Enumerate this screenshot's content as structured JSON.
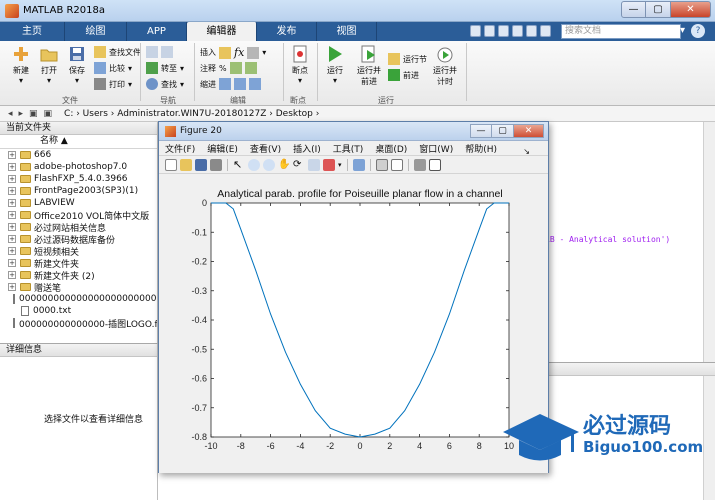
{
  "window": {
    "title": "MATLAB R2018a",
    "minimize": "—",
    "maximize": "▢",
    "close": "✕"
  },
  "tabs": [
    "主页",
    "绘图",
    "APP",
    "编辑器",
    "发布",
    "视图"
  ],
  "search_placeholder": "搜索文档",
  "ribbon": {
    "new": "新建",
    "open": "打开",
    "save": "保存",
    "find_files": "查找文件",
    "compare": "比较",
    "print": "打印",
    "goto": "转至",
    "find": "查找",
    "insert": "插入",
    "comment": "注释",
    "indent": "缩进",
    "breakpoints": "断点",
    "run": "运行",
    "run_and_advance": [
      "运行并",
      "前进"
    ],
    "run_section": "运行节",
    "advance": "前进",
    "run_and_time": [
      "运行并",
      "计时"
    ],
    "groups": {
      "file": "文件",
      "navigate": "导航",
      "edit": "编辑",
      "breakpoints": "断点",
      "run": "运行"
    }
  },
  "address": {
    "path": "C:  ›  Users  ›  Administrator.WIN7U-20180127Z  ›  Desktop  ›"
  },
  "current_folder": {
    "title": "当前文件夹",
    "column": "名称 ▲",
    "items": [
      {
        "name": "666",
        "type": "folder"
      },
      {
        "name": "adobe-photoshop7.0",
        "type": "folder"
      },
      {
        "name": "FlashFXP_5.4.0.3966",
        "type": "folder"
      },
      {
        "name": "FrontPage2003(SP3)(1)",
        "type": "folder"
      },
      {
        "name": "LABVIEW",
        "type": "folder"
      },
      {
        "name": "Office2010 VOL简体中文版",
        "type": "folder"
      },
      {
        "name": "必过网站相关信息",
        "type": "folder"
      },
      {
        "name": "必过源码数据库备份",
        "type": "folder"
      },
      {
        "name": "短视频相关",
        "type": "folder"
      },
      {
        "name": "新建文件夹",
        "type": "folder"
      },
      {
        "name": "新建文件夹 (2)",
        "type": "folder"
      },
      {
        "name": "赠送笔",
        "type": "folder"
      },
      {
        "name": "00000000000000000000000000...",
        "type": "file"
      },
      {
        "name": "0000.txt",
        "type": "file"
      },
      {
        "name": "000000000000000-插图LOGO.f...",
        "type": "file"
      }
    ]
  },
  "details": {
    "title": "详细信息",
    "message": "选择文件以查看详细信息"
  },
  "command_snippet": "LB - Analytical solution')",
  "figure": {
    "title": "Figure 20",
    "menus": [
      "文件(F)",
      "编辑(E)",
      "查看(V)",
      "插入(I)",
      "工具(T)",
      "桌面(D)",
      "窗口(W)",
      "帮助(H)"
    ]
  },
  "chart_data": {
    "type": "line",
    "title": "Analytical parab. profile for Poiseuille planar flow in a channel",
    "xlabel": "",
    "ylabel": "",
    "xlim": [
      -10,
      10
    ],
    "ylim": [
      -0.8,
      0
    ],
    "xticks": [
      -10,
      -8,
      -6,
      -4,
      -2,
      0,
      2,
      4,
      6,
      8,
      10
    ],
    "yticks": [
      0,
      -0.1,
      -0.2,
      -0.3,
      -0.4,
      -0.5,
      -0.6,
      -0.7,
      -0.8
    ],
    "grid": false,
    "series_color": "#0072bd",
    "x": [
      -10,
      -9,
      -8.5,
      -8,
      -7,
      -6,
      -5,
      -4,
      -3,
      -2,
      -1,
      0,
      1,
      2,
      3,
      4,
      5,
      6,
      7,
      8,
      8.5,
      9,
      10
    ],
    "y": [
      0,
      0,
      -0.02,
      -0.09,
      -0.23,
      -0.38,
      -0.51,
      -0.62,
      -0.71,
      -0.77,
      -0.79,
      -0.8,
      -0.79,
      -0.77,
      -0.71,
      -0.62,
      -0.51,
      -0.38,
      -0.23,
      -0.09,
      -0.02,
      0,
      0
    ]
  },
  "watermark": {
    "main": "必过源码",
    "sub": "Biguo100.com"
  }
}
